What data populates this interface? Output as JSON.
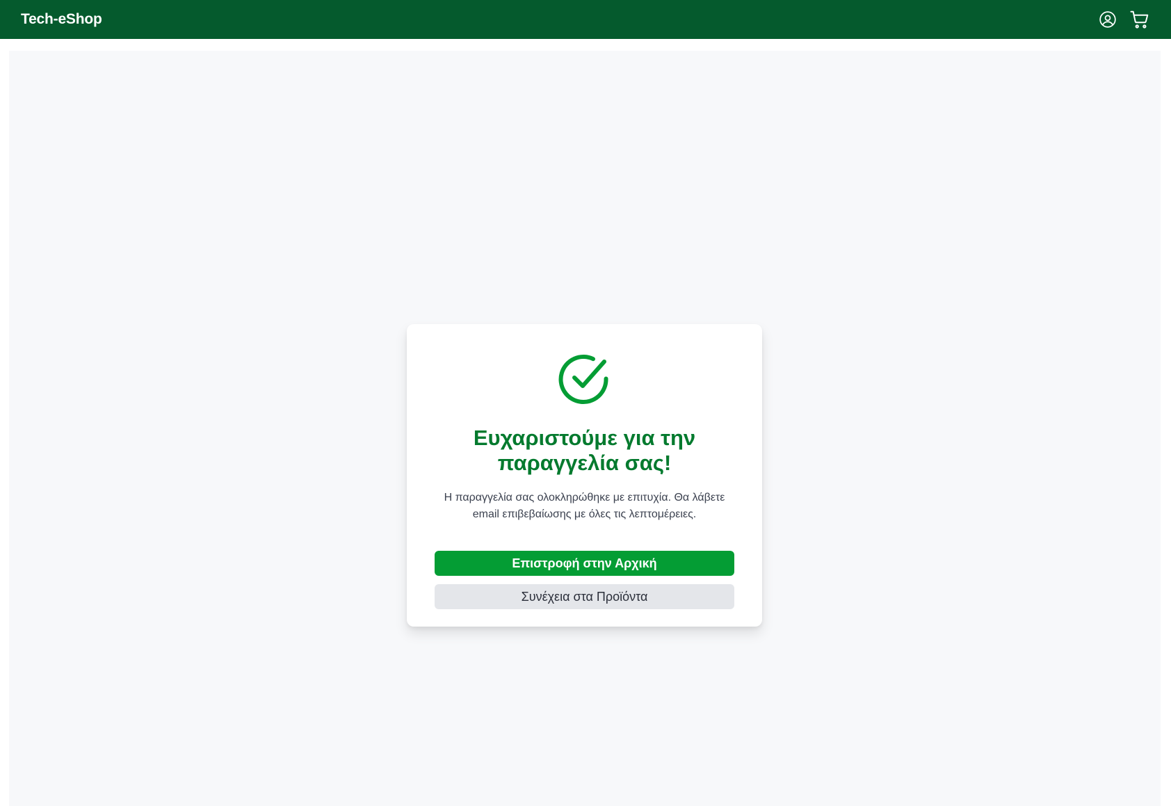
{
  "header": {
    "brand": "Tech-eShop",
    "account_icon": "user-circle-icon",
    "cart_icon": "shopping-cart-icon"
  },
  "confirmation": {
    "icon": "check-circle-icon",
    "title_line1": "Ευχαριστούμε για την",
    "title_line2": "παραγγελία σας!",
    "message_line1": "Η παραγγελία σας ολοκληρώθηκε με επιτυχία. Θα λάβετε",
    "message_line2": "email επιβεβαίωσης με όλες τις λεπτομέρειες.",
    "primary_button": "Επιστροφή στην Αρχική",
    "secondary_button": "Συνέχεια στα Προϊόντα"
  },
  "colors": {
    "header_bg": "#055a2d",
    "accent": "#049d34",
    "title": "#047a2e",
    "panel_bg": "#f7f8fa",
    "secondary_button_bg": "#e4e6ea"
  }
}
